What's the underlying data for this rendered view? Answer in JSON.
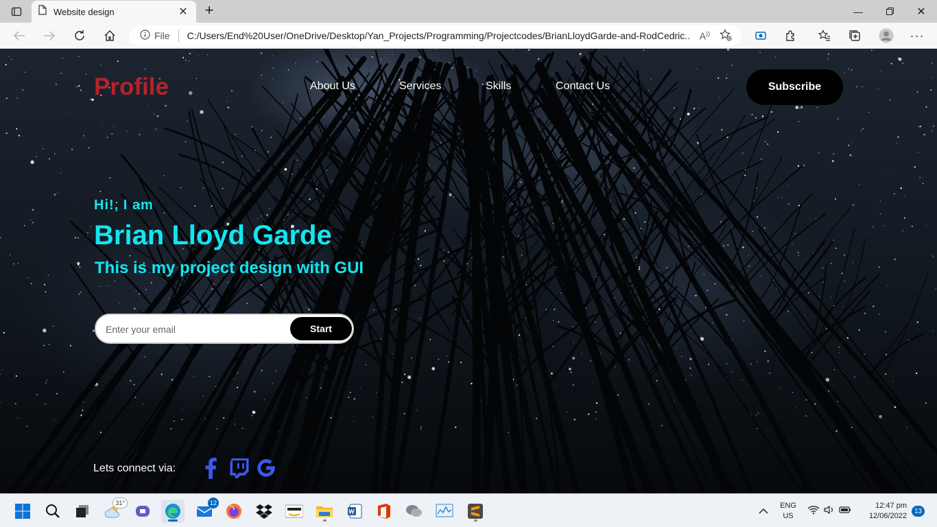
{
  "browser": {
    "tab_title": "Website design",
    "address_label": "File",
    "url": "C:/Users/End%20User/OneDrive/Desktop/Yan_Projects/Programming/Projectcodes/BrianLloydGarde-and-RodCedric..."
  },
  "site": {
    "logo": "Profile",
    "menu": [
      "About Us",
      "Services",
      "Skills",
      "Contact Us"
    ],
    "subscribe_label": "Subscribe",
    "greeting": "Hi!, I am",
    "name": "Brian Lloyd Garde",
    "tagline": "This is my project design with GUI",
    "email_placeholder": "Enter your email",
    "start_label": "Start",
    "connect_label": "Lets connect via:",
    "social_icons": [
      "facebook-icon",
      "twitch-icon",
      "google-icon"
    ],
    "colors": {
      "logo": "#b5222a",
      "accent": "#12e6f0",
      "social": "#3a58e8"
    }
  },
  "taskbar": {
    "weather_temp": "31°",
    "mail_badge": "12",
    "language": "ENG",
    "region": "US",
    "time": "12:47 pm",
    "date": "12/06/2022",
    "notification_count": "13"
  }
}
